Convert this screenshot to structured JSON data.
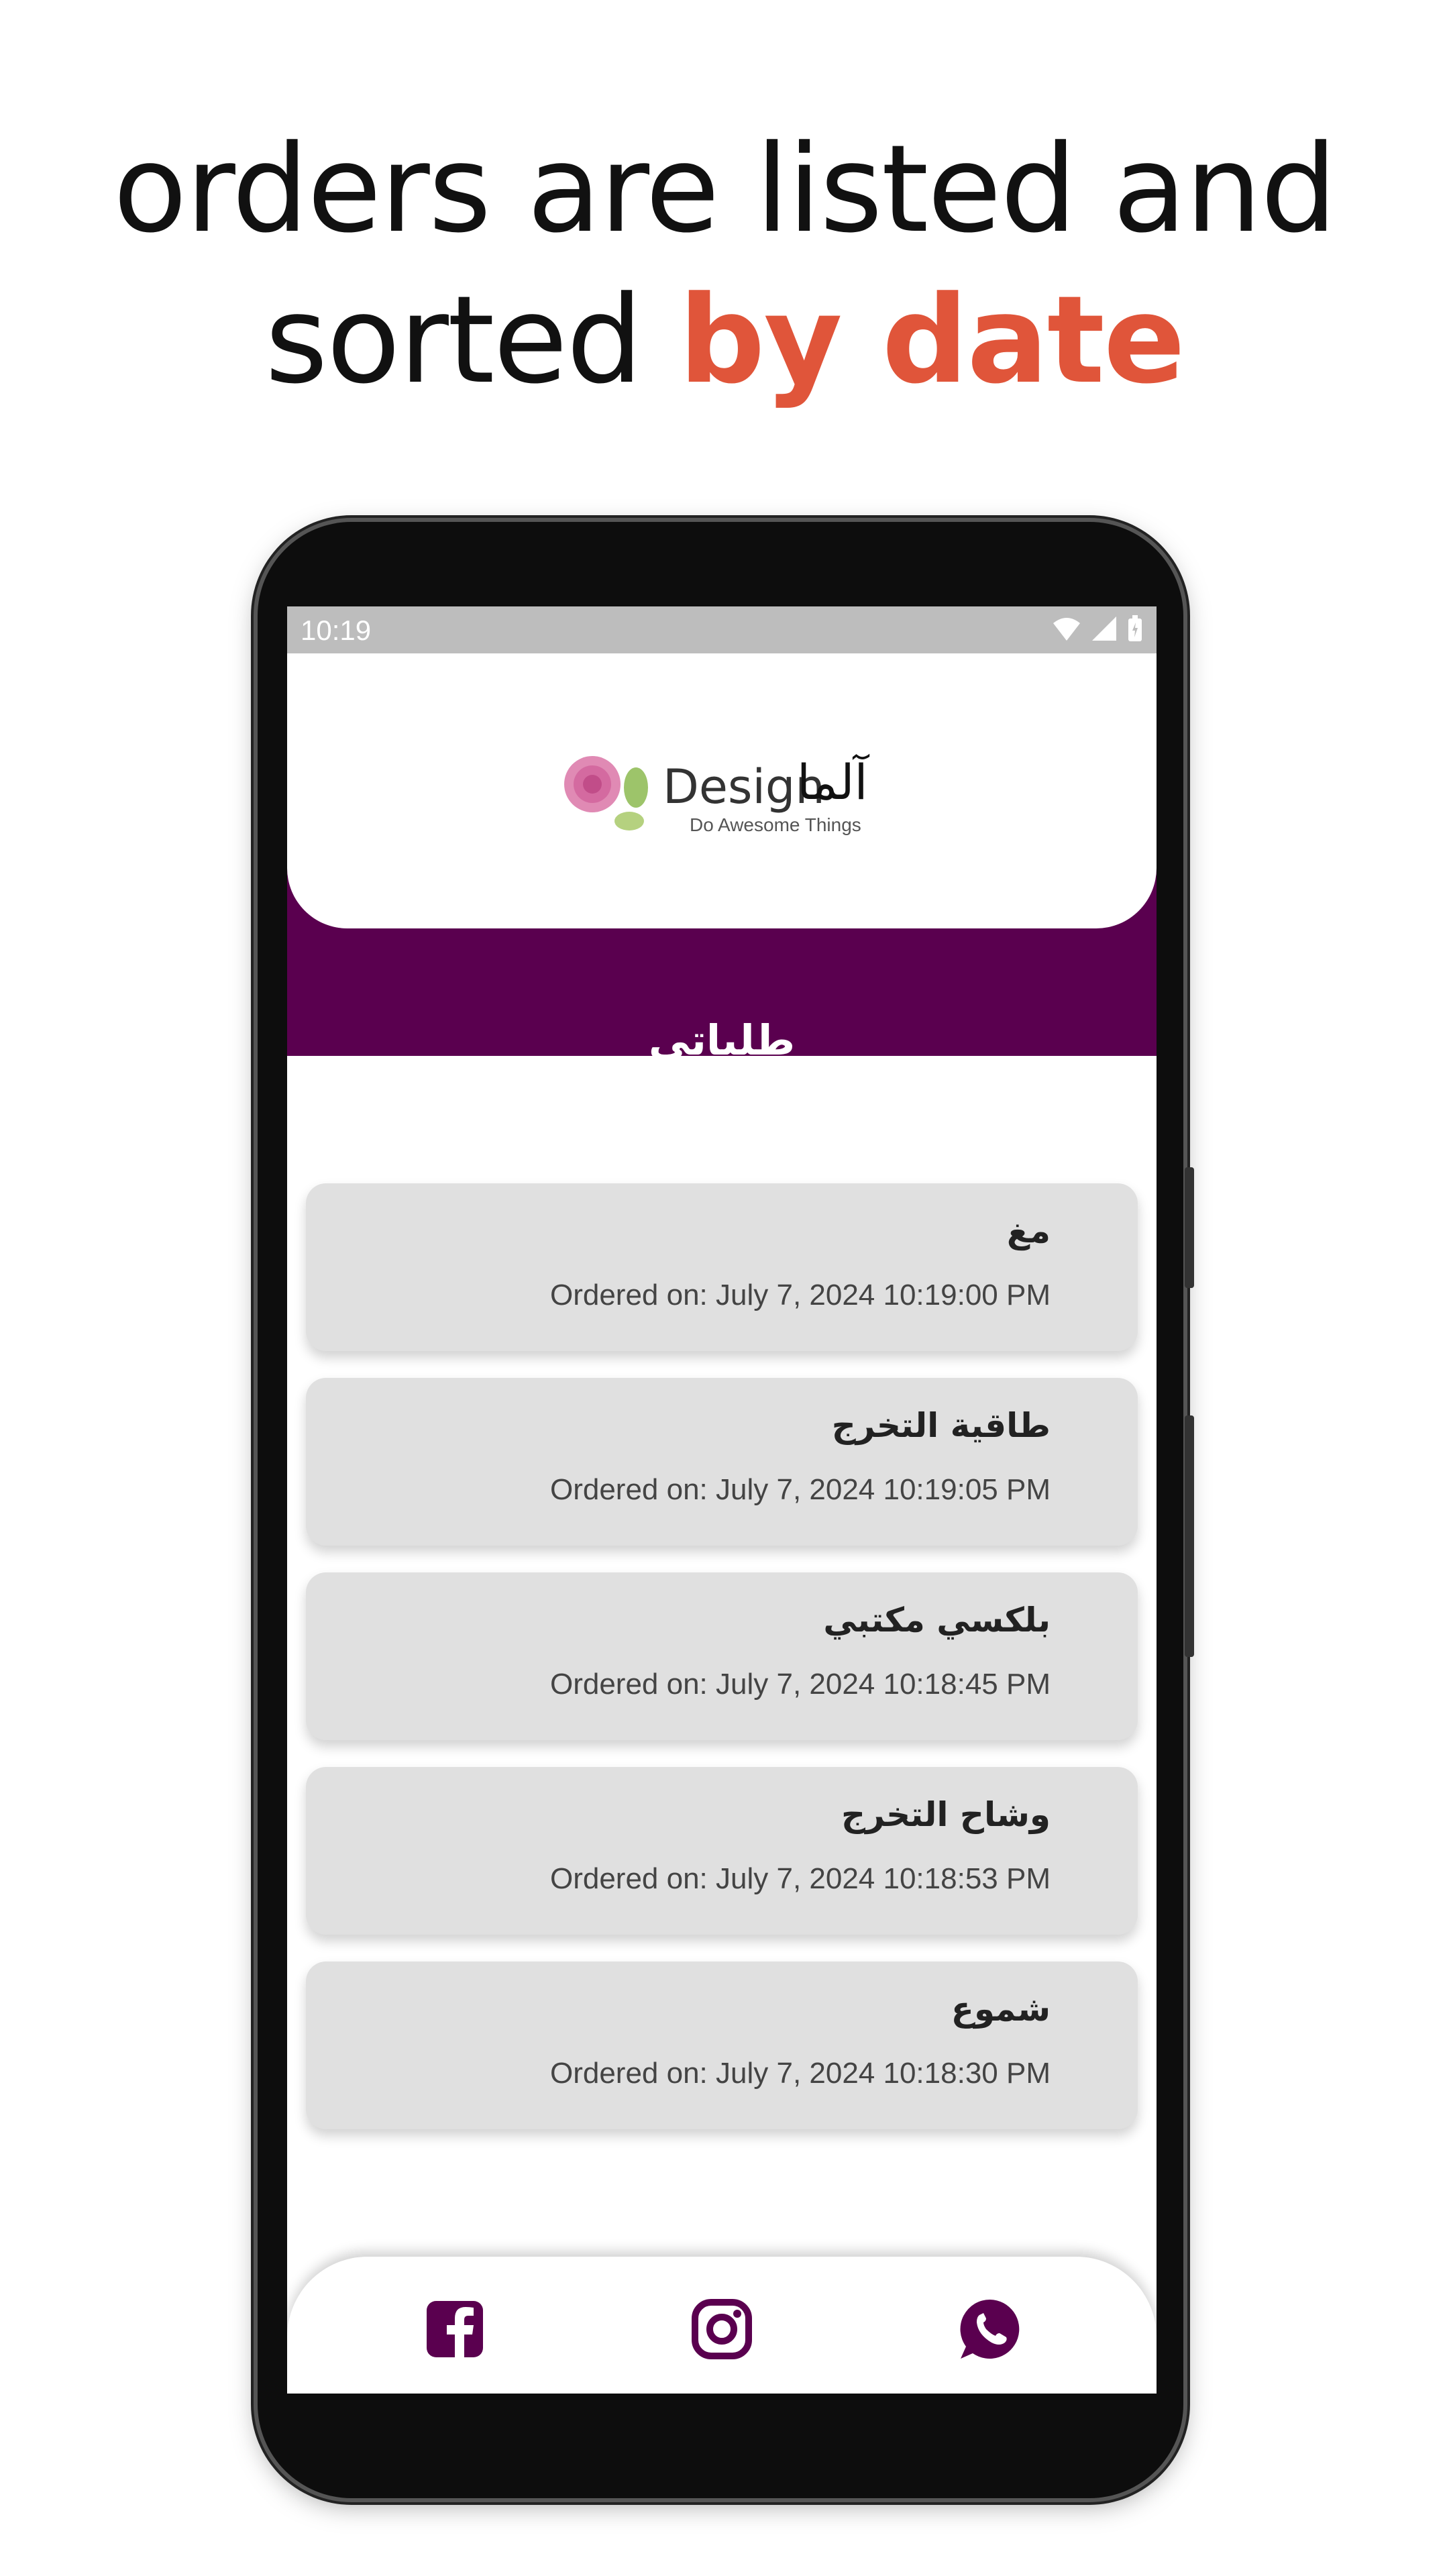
{
  "headline": {
    "line1": "orders are listed and",
    "line2_plain": "sorted ",
    "line2_accent": "by date"
  },
  "status_bar": {
    "time": "10:19"
  },
  "logo": {
    "text_latin": "Design",
    "text_arabic": "آلما",
    "tagline": "Do Awesome Things"
  },
  "page": {
    "title": "طلباتي"
  },
  "orders": [
    {
      "name": "مغ",
      "date": "Ordered on: July 7, 2024 10:19:00 PM"
    },
    {
      "name": "طاقية التخرج",
      "date": "Ordered on: July 7, 2024 10:19:05 PM"
    },
    {
      "name": "بلكسي مكتبي",
      "date": "Ordered on: July 7, 2024 10:18:45 PM"
    },
    {
      "name": "وشاح التخرج",
      "date": "Ordered on: July 7, 2024 10:18:53 PM"
    },
    {
      "name": "شموع",
      "date": "Ordered on: July 7, 2024 10:18:30 PM"
    }
  ],
  "bottom_nav": {
    "icons": [
      "facebook-icon",
      "instagram-icon",
      "whatsapp-icon"
    ]
  },
  "colors": {
    "brand": "#5a004f",
    "accent": "#e0553a",
    "card": "#e0e0e0"
  }
}
